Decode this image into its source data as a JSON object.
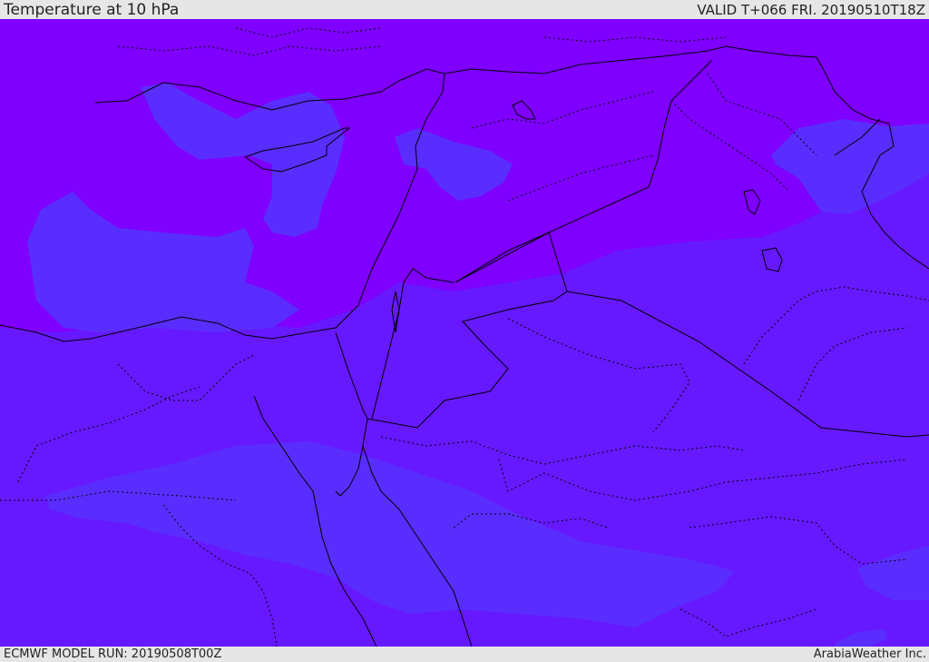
{
  "header": {
    "title": "Temperature at 10 hPa",
    "valid": "VALID T+066 FRI. 20190510T18Z"
  },
  "footer": {
    "model_run": "ECMWF MODEL RUN: 20190508T00Z",
    "credit": "ArabiaWeather Inc."
  },
  "map": {
    "colors": {
      "coldest": "#7f00ff",
      "cold": "#6619ff",
      "cool": "#5a2dff",
      "border_line": "#000000"
    }
  }
}
